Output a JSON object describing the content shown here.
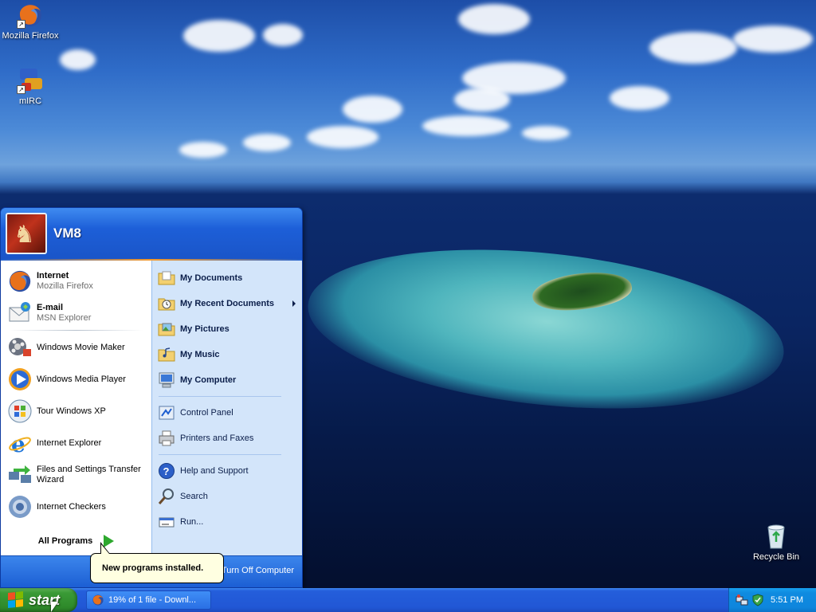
{
  "desktop": {
    "icons": [
      {
        "label": "Mozilla Firefox",
        "icon": "firefox-icon",
        "shortcut": true
      },
      {
        "label": "mIRC",
        "icon": "mirc-icon",
        "shortcut": true
      },
      {
        "label": "Recycle Bin",
        "icon": "recycle-bin-icon",
        "shortcut": false
      }
    ]
  },
  "start_menu": {
    "user_name": "VM8",
    "pinned": [
      {
        "title": "Internet",
        "subtitle": "Mozilla Firefox",
        "icon": "firefox-icon"
      },
      {
        "title": "E-mail",
        "subtitle": "MSN Explorer",
        "icon": "email-icon"
      }
    ],
    "recent": [
      {
        "label": "Windows Movie Maker",
        "icon": "movie-maker-icon"
      },
      {
        "label": "Windows Media Player",
        "icon": "media-player-icon"
      },
      {
        "label": "Tour Windows XP",
        "icon": "tour-xp-icon"
      },
      {
        "label": "Internet Explorer",
        "icon": "internet-explorer-icon"
      },
      {
        "label": "Files and Settings Transfer Wizard",
        "icon": "transfer-wizard-icon"
      },
      {
        "label": "Internet Checkers",
        "icon": "checkers-icon"
      }
    ],
    "all_programs_label": "All Programs",
    "places": [
      {
        "label": "My Documents",
        "icon": "folder-documents-icon"
      },
      {
        "label": "My Recent Documents",
        "icon": "recent-documents-icon"
      },
      {
        "label": "My Pictures",
        "icon": "folder-pictures-icon"
      },
      {
        "label": "My Music",
        "icon": "folder-music-icon"
      },
      {
        "label": "My Computer",
        "icon": "computer-icon"
      }
    ],
    "system": [
      {
        "label": "Control Panel",
        "icon": "control-panel-icon"
      },
      {
        "label": "Printers and Faxes",
        "icon": "printer-icon"
      }
    ],
    "tools": [
      {
        "label": "Help and Support",
        "icon": "help-icon"
      },
      {
        "label": "Search",
        "icon": "search-icon"
      },
      {
        "label": "Run...",
        "icon": "run-icon"
      }
    ],
    "turn_off_label": "Turn Off Computer"
  },
  "balloon": {
    "text": "New programs installed."
  },
  "taskbar": {
    "start_label": "start",
    "task_button_label": "19% of 1 file - Downl...",
    "clock": "5:51 PM"
  },
  "colors": {
    "taskbar_blue": "#245edb",
    "start_green": "#3a9a36",
    "tray_blue": "#0f8be0",
    "menu_right_pane": "#d3e5fa",
    "balloon_yellow": "#ffffe1"
  }
}
